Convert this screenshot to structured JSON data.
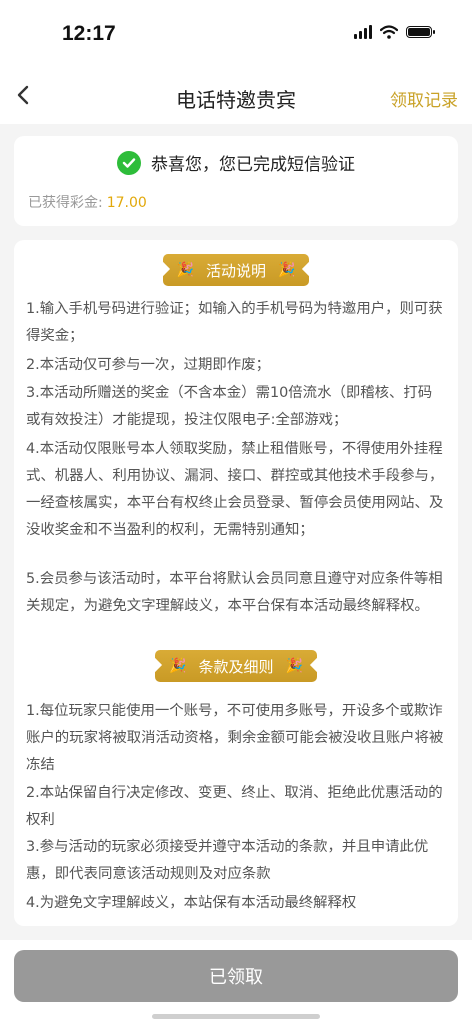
{
  "status_bar": {
    "time": "12:17"
  },
  "nav": {
    "title": "电话特邀贵宾",
    "action": "领取记录"
  },
  "verify": {
    "message": "恭喜您，您已完成短信验证",
    "earned_label": "已获得彩金:",
    "earned_value": "17.00"
  },
  "section1": {
    "title": "活动说明",
    "rules": [
      "1.输入手机号码进行验证；如输入的手机号码为特邀用户，则可获得奖金；",
      "2.本活动仅可参与一次，过期即作废；",
      "3.本活动所赠送的奖金（不含本金）需10倍流水（即稽核、打码或有效投注）才能提现，投注仅限电子:全部游戏；",
      "4.本活动仅限账号本人领取奖励，禁止租借账号，不得使用外挂程式、机器人、利用协议、漏洞、接口、群控或其他技术手段参与，一经查核属实，本平台有权终止会员登录、暂停会员使用网站、及没收奖金和不当盈利的权利，无需特别通知；",
      "5.会员参与该活动时，本平台将默认会员同意且遵守对应条件等相关规定，为避免文字理解歧义，本平台保有本活动最终解释权。"
    ]
  },
  "section2": {
    "title": "条款及细则",
    "rules": [
      "1.每位玩家只能使用一个账号，不可使用多账号，开设多个或欺诈账户的玩家将被取消活动资格，剩余金额可能会被没收且账户将被冻结",
      "2.本站保留自行决定修改、变更、终止、取消、拒绝此优惠活动的权利",
      "3.参与活动的玩家必须接受并遵守本活动的条款，并且申请此优惠，即代表同意该活动规则及对应条款",
      "4.为避免文字理解歧义，本站保有本活动最终解释权"
    ]
  },
  "footer": {
    "button": "已领取"
  }
}
